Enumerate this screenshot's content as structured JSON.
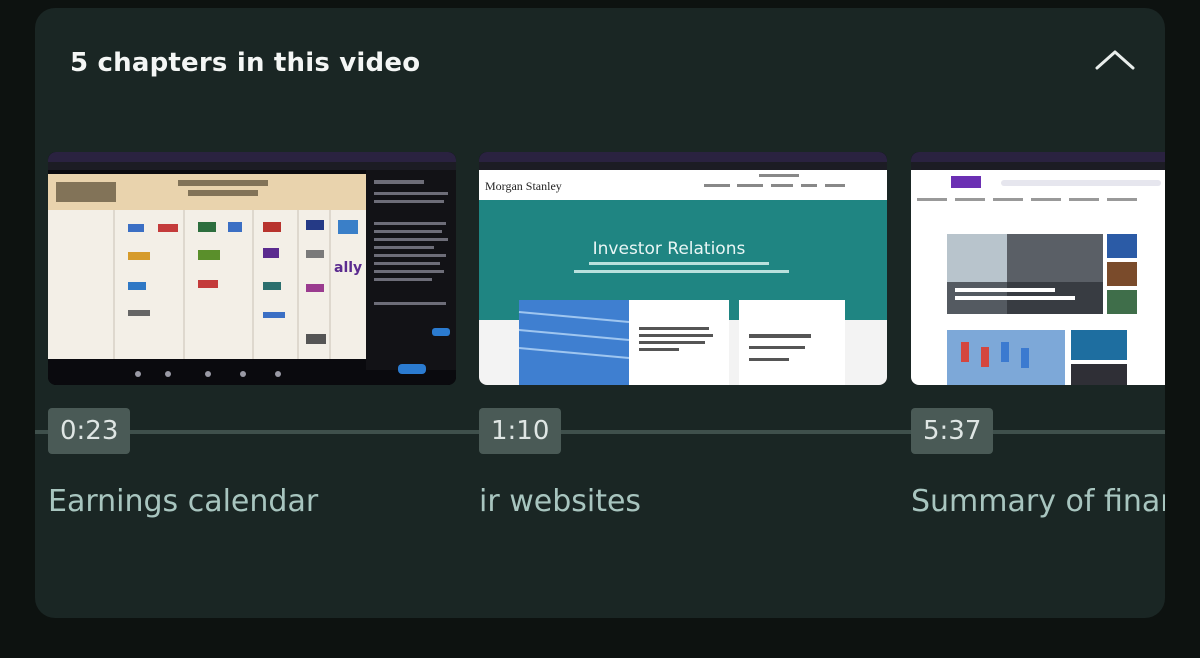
{
  "header": {
    "title": "5 chapters in this video"
  },
  "chapters": [
    {
      "time": "0:23",
      "title": "Earnings calendar"
    },
    {
      "time": "1:10",
      "title": "ir websites"
    },
    {
      "time": "5:37",
      "title": "Summary of finan"
    }
  ],
  "thumbnails": {
    "ir": {
      "brand": "Morgan Stanley",
      "hero_text": "Investor Relations"
    },
    "calendar": {
      "ticker_logo": "ally"
    }
  },
  "colors": {
    "panel": "#1a2624",
    "track": "#3f504c",
    "badge": "#4a5a56",
    "chapter_title": "#a8c5bf",
    "ms_teal": "#1f8582"
  }
}
